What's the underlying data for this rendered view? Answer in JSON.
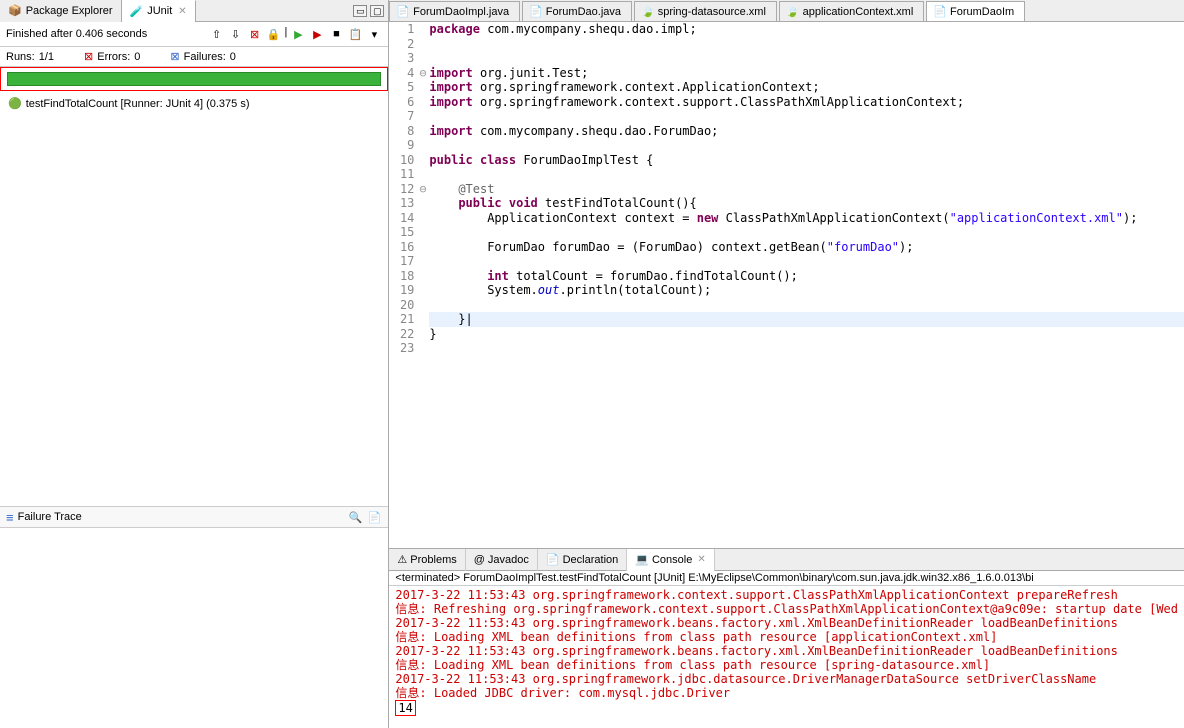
{
  "leftPanel": {
    "tabs": {
      "packageExplorer": "Package Explorer",
      "junit": "JUnit"
    },
    "statusText": "Finished after 0.406 seconds",
    "metrics": {
      "runsLabel": "Runs:",
      "runsValue": "1/1",
      "errorsLabel": "Errors:",
      "errorsValue": "0",
      "failuresLabel": "Failures:",
      "failuresValue": "0"
    },
    "testItem": "testFindTotalCount [Runner: JUnit 4] (0.375 s)",
    "failureTraceLabel": "Failure Trace"
  },
  "editorTabs": {
    "t1": "ForumDaoImpl.java",
    "t2": "ForumDao.java",
    "t3": "spring-datasource.xml",
    "t4": "applicationContext.xml",
    "t5": "ForumDaoIm"
  },
  "code": {
    "lines": [
      {
        "n": "1",
        "f": "",
        "t": [
          {
            "c": "kw",
            "v": "package"
          },
          {
            "c": "",
            "v": " com.mycompany.shequ.dao.impl;"
          }
        ]
      },
      {
        "n": "2",
        "f": "",
        "t": []
      },
      {
        "n": "3",
        "f": "",
        "t": []
      },
      {
        "n": "4",
        "f": "⊖",
        "t": [
          {
            "c": "kw",
            "v": "import"
          },
          {
            "c": "",
            "v": " org.junit.Test;"
          }
        ]
      },
      {
        "n": "5",
        "f": "",
        "t": [
          {
            "c": "kw",
            "v": "import"
          },
          {
            "c": "",
            "v": " org.springframework.context.ApplicationContext;"
          }
        ]
      },
      {
        "n": "6",
        "f": "",
        "t": [
          {
            "c": "kw",
            "v": "import"
          },
          {
            "c": "",
            "v": " org.springframework.context.support.ClassPathXmlApplicationContext;"
          }
        ]
      },
      {
        "n": "7",
        "f": "",
        "t": []
      },
      {
        "n": "8",
        "f": "",
        "t": [
          {
            "c": "kw",
            "v": "import"
          },
          {
            "c": "",
            "v": " com.mycompany.shequ.dao.ForumDao;"
          }
        ]
      },
      {
        "n": "9",
        "f": "",
        "t": []
      },
      {
        "n": "10",
        "f": "",
        "t": [
          {
            "c": "kw",
            "v": "public class"
          },
          {
            "c": "",
            "v": " ForumDaoImplTest {"
          }
        ]
      },
      {
        "n": "11",
        "f": "",
        "t": []
      },
      {
        "n": "12",
        "f": "⊖",
        "t": [
          {
            "c": "",
            "v": "    "
          },
          {
            "c": "ann",
            "v": "@Test"
          }
        ]
      },
      {
        "n": "13",
        "f": "",
        "t": [
          {
            "c": "",
            "v": "    "
          },
          {
            "c": "kw",
            "v": "public void"
          },
          {
            "c": "",
            "v": " testFindTotalCount(){"
          }
        ]
      },
      {
        "n": "14",
        "f": "",
        "t": [
          {
            "c": "",
            "v": "        ApplicationContext context = "
          },
          {
            "c": "kw",
            "v": "new"
          },
          {
            "c": "",
            "v": " ClassPathXmlApplicationContext("
          },
          {
            "c": "str",
            "v": "\"applicationContext.xml\""
          },
          {
            "c": "",
            "v": ");"
          }
        ]
      },
      {
        "n": "15",
        "f": "",
        "t": []
      },
      {
        "n": "16",
        "f": "",
        "t": [
          {
            "c": "",
            "v": "        ForumDao forumDao = (ForumDao) context.getBean("
          },
          {
            "c": "str",
            "v": "\"forumDao\""
          },
          {
            "c": "",
            "v": ");"
          }
        ]
      },
      {
        "n": "17",
        "f": "",
        "t": []
      },
      {
        "n": "18",
        "f": "",
        "t": [
          {
            "c": "",
            "v": "        "
          },
          {
            "c": "kw",
            "v": "int"
          },
          {
            "c": "",
            "v": " totalCount = forumDao.findTotalCount();"
          }
        ]
      },
      {
        "n": "19",
        "f": "",
        "t": [
          {
            "c": "",
            "v": "        System."
          },
          {
            "c": "static",
            "v": "out"
          },
          {
            "c": "",
            "v": ".println(totalCount);"
          }
        ]
      },
      {
        "n": "20",
        "f": "",
        "t": []
      },
      {
        "n": "21",
        "f": "",
        "hl": true,
        "t": [
          {
            "c": "",
            "v": "    }|"
          }
        ]
      },
      {
        "n": "22",
        "f": "",
        "t": [
          {
            "c": "",
            "v": "}"
          }
        ]
      },
      {
        "n": "23",
        "f": "",
        "t": []
      }
    ]
  },
  "bottomPanel": {
    "tabs": {
      "problems": "Problems",
      "javadoc": "Javadoc",
      "declaration": "Declaration",
      "console": "Console"
    },
    "terminated": "<terminated> ForumDaoImplTest.testFindTotalCount [JUnit] E:\\MyEclipse\\Common\\binary\\com.sun.java.jdk.win32.x86_1.6.0.013\\bi",
    "consoleLines": [
      "2017-3-22 11:53:43 org.springframework.context.support.ClassPathXmlApplicationContext prepareRefresh",
      "信息: Refreshing org.springframework.context.support.ClassPathXmlApplicationContext@a9c09e: startup date [Wed",
      "2017-3-22 11:53:43 org.springframework.beans.factory.xml.XmlBeanDefinitionReader loadBeanDefinitions",
      "信息: Loading XML bean definitions from class path resource [applicationContext.xml]",
      "2017-3-22 11:53:43 org.springframework.beans.factory.xml.XmlBeanDefinitionReader loadBeanDefinitions",
      "信息: Loading XML bean definitions from class path resource [spring-datasource.xml]",
      "2017-3-22 11:53:43 org.springframework.jdbc.datasource.DriverManagerDataSource setDriverClassName",
      "信息: Loaded JDBC driver: com.mysql.jdbc.Driver"
    ],
    "resultValue": "14"
  }
}
